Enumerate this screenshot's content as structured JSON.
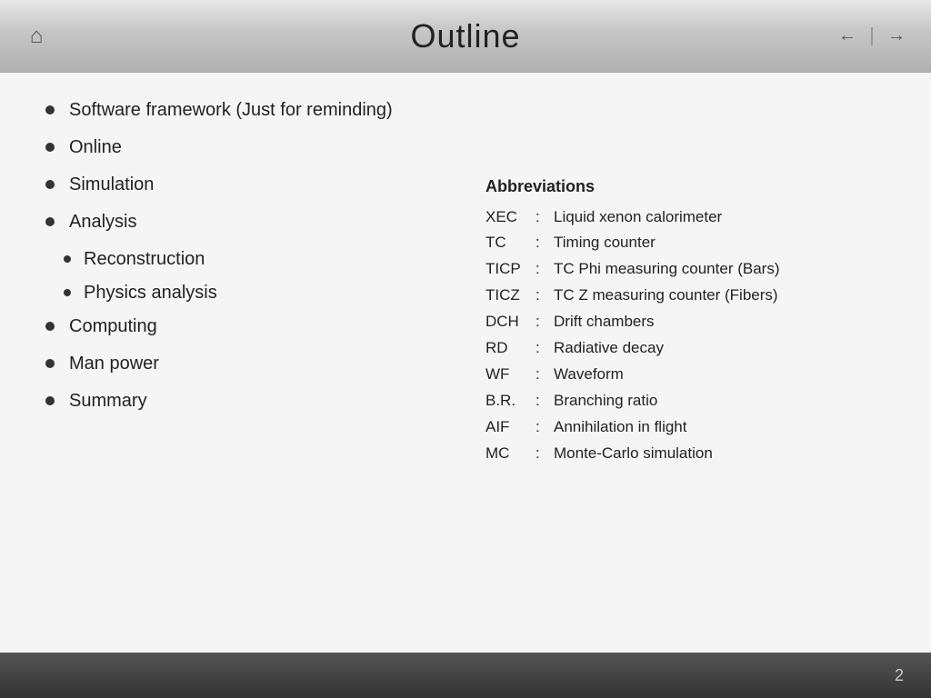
{
  "header": {
    "title": "Outline",
    "home_icon": "⌂",
    "nav_back": "←",
    "nav_forward": "→"
  },
  "bullets": [
    {
      "id": "b1",
      "text": "Software framework (Just for reminding)",
      "level": 1
    },
    {
      "id": "b2",
      "text": "Online",
      "level": 1
    },
    {
      "id": "b3",
      "text": "Simulation",
      "level": 1
    },
    {
      "id": "b4",
      "text": "Analysis",
      "level": 1
    },
    {
      "id": "b5",
      "text": "Reconstruction",
      "level": 2
    },
    {
      "id": "b6",
      "text": "Physics analysis",
      "level": 2
    },
    {
      "id": "b7",
      "text": "Computing",
      "level": 1
    },
    {
      "id": "b8",
      "text": "Man power",
      "level": 1
    },
    {
      "id": "b9",
      "text": "Summary",
      "level": 1
    }
  ],
  "abbreviations": {
    "title": "Abbreviations",
    "items": [
      {
        "key": "XEC",
        "value": "Liquid xenon calorimeter"
      },
      {
        "key": "TC",
        "value": "Timing counter"
      },
      {
        "key": "TICP",
        "value": "TC Phi measuring counter (Bars)"
      },
      {
        "key": "TICZ",
        "value": "TC Z measuring counter (Fibers)"
      },
      {
        "key": "DCH",
        "value": "Drift chambers"
      },
      {
        "key": "RD",
        "value": "Radiative decay"
      },
      {
        "key": "WF",
        "value": "Waveform"
      },
      {
        "key": "B.R.",
        "value": "Branching ratio"
      },
      {
        "key": "AIF",
        "value": "Annihilation in flight"
      },
      {
        "key": "MC",
        "value": "Monte-Carlo simulation"
      }
    ]
  },
  "footer": {
    "page_number": "2"
  }
}
